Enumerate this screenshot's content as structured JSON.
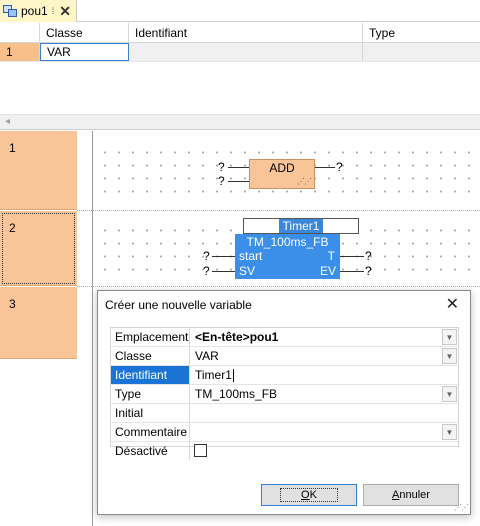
{
  "tab": {
    "label": "pou1",
    "pin": "⁞",
    "close": "✕"
  },
  "table": {
    "headers": [
      "",
      "Classe",
      "Identifiant",
      "Type"
    ],
    "rows": [
      {
        "num": "1",
        "classe": "VAR",
        "identifiant": "",
        "type": ""
      }
    ]
  },
  "scroll_arrow": "◂",
  "rungs": [
    {
      "num": "1"
    },
    {
      "num": "2"
    },
    {
      "num": "3"
    }
  ],
  "add_block": {
    "name": "ADD",
    "grip": "⋰⋰"
  },
  "timer": {
    "instance": "Timer1",
    "type": "TM_100ms_FB",
    "in1": "start",
    "in2": "SV",
    "out1": "T",
    "out2": "EV"
  },
  "unknown": "?",
  "dialog": {
    "title": "Créer une nouvelle variable",
    "close": "✕",
    "fields": [
      {
        "label": "Emplacement",
        "value_bold": "<En-tête>",
        "value": " pou1",
        "dropdown": true
      },
      {
        "label": "Classe",
        "value": "VAR",
        "dropdown": true
      },
      {
        "label": "Identifiant",
        "value": "Timer1",
        "selected": true
      },
      {
        "label": "Type",
        "value": "TM_100ms_FB",
        "dropdown": true
      },
      {
        "label": "Initial",
        "value": ""
      },
      {
        "label": "Commentaire",
        "value": "",
        "dropdown": true
      },
      {
        "label": "Désactivé",
        "checkbox": false
      }
    ],
    "ok_label_pre": "",
    "ok_label_u": "O",
    "ok_label_post": "K",
    "cancel_label_pre": "",
    "cancel_label_u": "A",
    "cancel_label_post": "nnuler"
  },
  "colors": {
    "rung": "#f9c497",
    "selection": "#1b74d4",
    "fb_block": "#3b8fe8"
  },
  "icons": {
    "tab": "pou-icon",
    "dropdown": "chevron-down-icon"
  }
}
